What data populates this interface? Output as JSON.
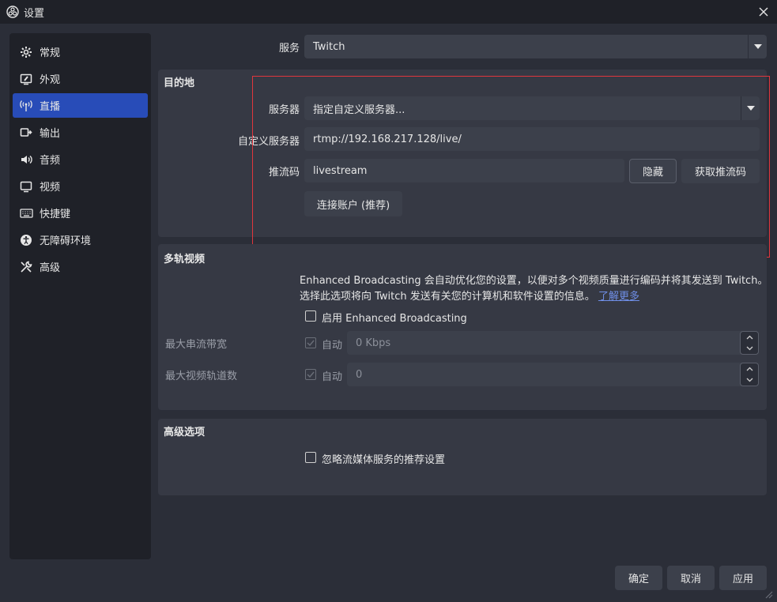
{
  "window": {
    "title": "设置"
  },
  "sidebar": {
    "items": [
      {
        "label": "常规",
        "icon": "gear-icon"
      },
      {
        "label": "外观",
        "icon": "appearance-icon"
      },
      {
        "label": "直播",
        "icon": "broadcast-icon",
        "active": true
      },
      {
        "label": "输出",
        "icon": "output-icon"
      },
      {
        "label": "音频",
        "icon": "speaker-icon"
      },
      {
        "label": "视频",
        "icon": "monitor-icon"
      },
      {
        "label": "快捷键",
        "icon": "keyboard-icon"
      },
      {
        "label": "无障碍环境",
        "icon": "accessibility-icon"
      },
      {
        "label": "高级",
        "icon": "tools-icon"
      }
    ]
  },
  "service": {
    "label": "服务",
    "value": "Twitch"
  },
  "destination": {
    "title": "目的地",
    "server_label": "服务器",
    "server_value": "指定自定义服务器...",
    "custom_server_label": "自定义服务器",
    "custom_server_value": "rtmp://192.168.217.128/live/",
    "stream_key_label": "推流码",
    "stream_key_value": "livestream",
    "hide_button": "隐藏",
    "get_key_button": "获取推流码",
    "connect_account_button": "连接账户 (推荐)"
  },
  "multitrack": {
    "title": "多轨视频",
    "description_line1": "Enhanced Broadcasting 会自动优化您的设置，以便对多个视频质量进行编码并将其发送到 Twitch。",
    "description_line2": "选择此选项将向 Twitch 发送有关您的计算机和软件设置的信息。",
    "learn_more": "了解更多",
    "enable_label": "启用 Enhanced Broadcasting",
    "max_bitrate_label": "最大串流带宽",
    "max_bitrate_auto": "自动",
    "max_bitrate_value": "0 Kbps",
    "max_tracks_label": "最大视频轨道数",
    "max_tracks_auto": "自动",
    "max_tracks_value": "0"
  },
  "advanced": {
    "title": "高级选项",
    "ignore_label": "忽略流媒体服务的推荐设置"
  },
  "footer": {
    "ok": "确定",
    "cancel": "取消",
    "apply": "应用"
  },
  "colors": {
    "accent": "#284cb8",
    "highlight": "#e0363d",
    "link": "#6f8ee6"
  }
}
